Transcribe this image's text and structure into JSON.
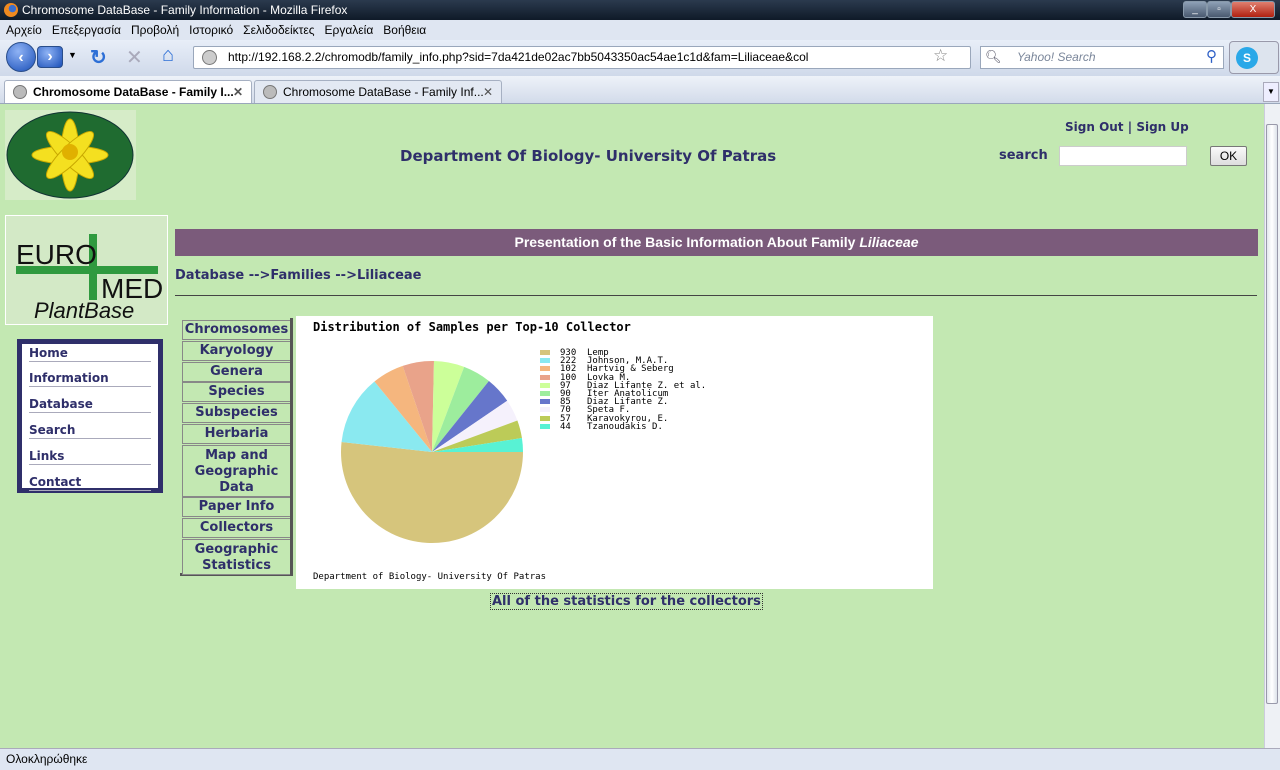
{
  "window": {
    "title": "Chromosome DataBase - Family Information - Mozilla Firefox"
  },
  "menu": [
    "Αρχείο",
    "Επεξεργασία",
    "Προβολή",
    "Ιστορικό",
    "Σελιδοδείκτες",
    "Εργαλεία",
    "Βοήθεια"
  ],
  "navbar": {
    "url": "http://192.168.2.2/chromodb/family_info.php?sid=7da421de02ac7bb5043350ac54ae1c1d&fam=Liliaceae&col",
    "search_placeholder": "Yahoo! Search"
  },
  "tabs": [
    {
      "label": "Chromosome DataBase - Family I...",
      "active": true
    },
    {
      "label": "Chromosome DataBase - Family Inf...",
      "active": false
    }
  ],
  "status": "Ολοκληρώθηκε",
  "header": {
    "dept": "Department Of Biology- University Of Patras",
    "sign_out": "Sign Out",
    "sep": "|",
    "sign_up": "Sign Up",
    "search_label": "search",
    "search_value": "",
    "ok": "OK"
  },
  "logo2": {
    "euro": "EURO",
    "med": "MED",
    "plantbase": "PlantBase"
  },
  "banner": {
    "text": "Presentation of the Basic Information About Family ",
    "family": "Liliaceae"
  },
  "breadcrumb": "Database -->Families -->Liliaceae",
  "leftnav": [
    "Home",
    "Information",
    "Database",
    "Search",
    "Links",
    "Contact"
  ],
  "subnav": [
    "Chromosomes",
    "Karyology",
    "Genera",
    "Species",
    "Subspecies",
    "Herbaria",
    "Map and Geographic Data",
    "Paper Info",
    "Collectors",
    "Geographic Statistics"
  ],
  "all_stats_link": "All of the statistics for the collectors",
  "chart_data": {
    "type": "pie",
    "title": "Distribution of Samples per Top-10 Collector",
    "footer": "Department of Biology- University Of Patras",
    "legend_placement": "right",
    "categories": [
      "Lemp",
      "Johnson, M.A.T.",
      "Hartvig & Seberg",
      "Lovka M.",
      "Diaz Lifante Z. et al.",
      "Iter Anatolicum",
      "Diaz Lifante Z.",
      "Speta F.",
      "Karavokyrou, E.",
      "Tzanoudakis D."
    ],
    "values": [
      930,
      222,
      102,
      100,
      97,
      90,
      85,
      70,
      57,
      44
    ],
    "colors": [
      "#d6c57c",
      "#8ae9f0",
      "#f5b67e",
      "#e9a38a",
      "#ccff99",
      "#9ded9d",
      "#6676cb",
      "#f5f1fc",
      "#bccb58",
      "#58f2d4"
    ]
  }
}
